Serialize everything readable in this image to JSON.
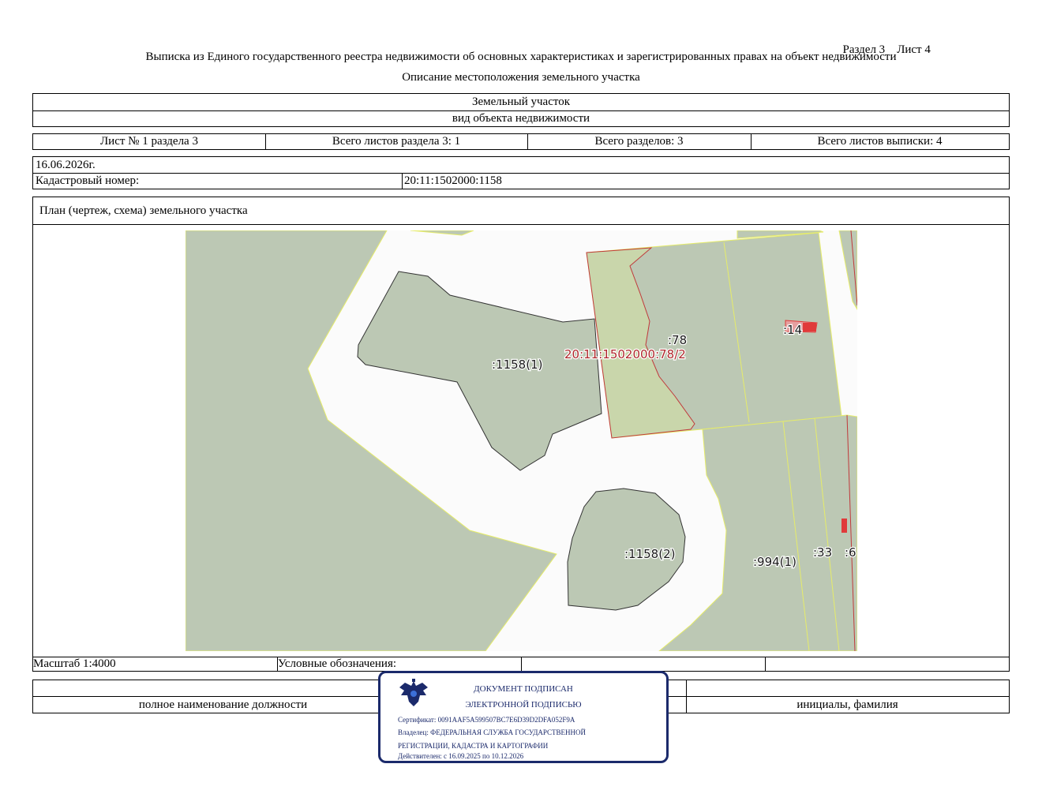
{
  "header": {
    "section_label": "Раздел 3",
    "sheet_label": "Лист 4",
    "title": "Выписка из Единого государственного реестра недвижимости об основных характеристиках и зарегистрированных правах на объект недвижимости",
    "subtitle": "Описание местоположения земельного участка"
  },
  "object": {
    "name": "Земельный участок",
    "kind_caption": "вид объекта недвижимости"
  },
  "sheets": {
    "sheet_no": "Лист № 1 раздела 3",
    "total_section_sheets": "Всего листов раздела 3: 1",
    "total_sections": "Всего разделов: 3",
    "total_extract_sheets": "Всего листов выписки: 4"
  },
  "date": "16.06.2026г.",
  "cadastral": {
    "label": "Кадастровый номер:",
    "value": "20:11:1502000:1158"
  },
  "plan": {
    "title": "План (чертеж, схема) земельного участка",
    "map_labels": {
      "p1158_1": ":1158(1)",
      "p1158_2": ":1158(2)",
      "p78": ":78",
      "p78_2": "20:11:1502000:78/2",
      "p14": ":14",
      "p994_1": ":994(1)",
      "p33": ":33",
      "p6": ":6"
    },
    "colors": {
      "parcel_fill": "#bcc8b4",
      "background": "#fbfbfb",
      "selected_fill": "#c9d6ab",
      "boundary_line": "#e6ec6a",
      "red_outline": "#c0393b",
      "building": "#e03a3a"
    }
  },
  "footer": {
    "scale": "Масштаб 1:4000",
    "legend_label": "Условные обозначения:",
    "position_caption": "полное наименование должности",
    "name_caption": "инициалы, фамилия"
  },
  "stamp": {
    "line1": "ДОКУМЕНТ ПОДПИСАН",
    "line2": "ЭЛЕКТРОННОЙ ПОДПИСЬЮ",
    "certificate": "Сертификат: 0091AAF5A599507BC7E6D39D2DFA052F9A",
    "owner_line1": "Владелец: ФЕДЕРАЛЬНАЯ СЛУЖБА ГОСУДАРСТВЕННОЙ",
    "owner_line2": "РЕГИСТРАЦИИ, КАДАСТРА И КАРТОГРАФИИ",
    "valid": "Действителен: с 16.09.2025 по 10.12.2026",
    "emblem_icon": "double-headed-eagle-icon",
    "color": "#1b2a6b"
  }
}
